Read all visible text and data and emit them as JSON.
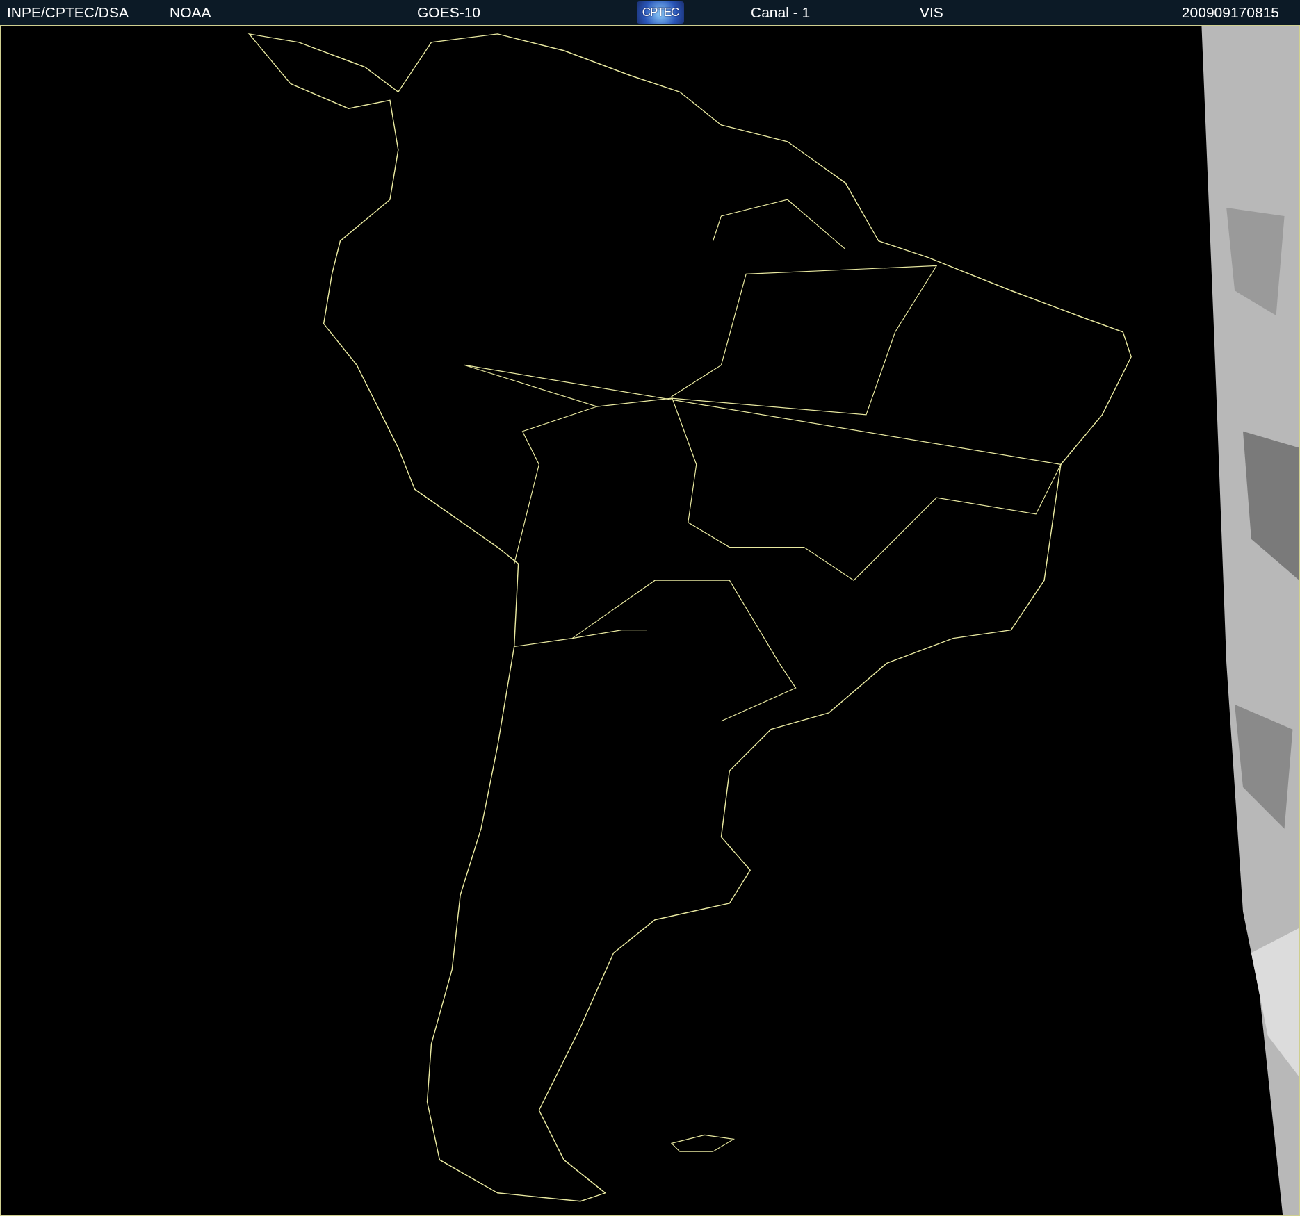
{
  "header": {
    "items": [
      {
        "kind": "text",
        "text": "INPE/CPTEC/DSA"
      },
      {
        "kind": "text",
        "text": "NOAA"
      },
      {
        "kind": "text",
        "text": "GOES-10"
      },
      {
        "kind": "logo",
        "text": "CPTEC"
      },
      {
        "kind": "text",
        "text": "Canal - 1"
      },
      {
        "kind": "text",
        "text": "VIS"
      },
      {
        "kind": "text",
        "text": "200909170815"
      }
    ]
  }
}
